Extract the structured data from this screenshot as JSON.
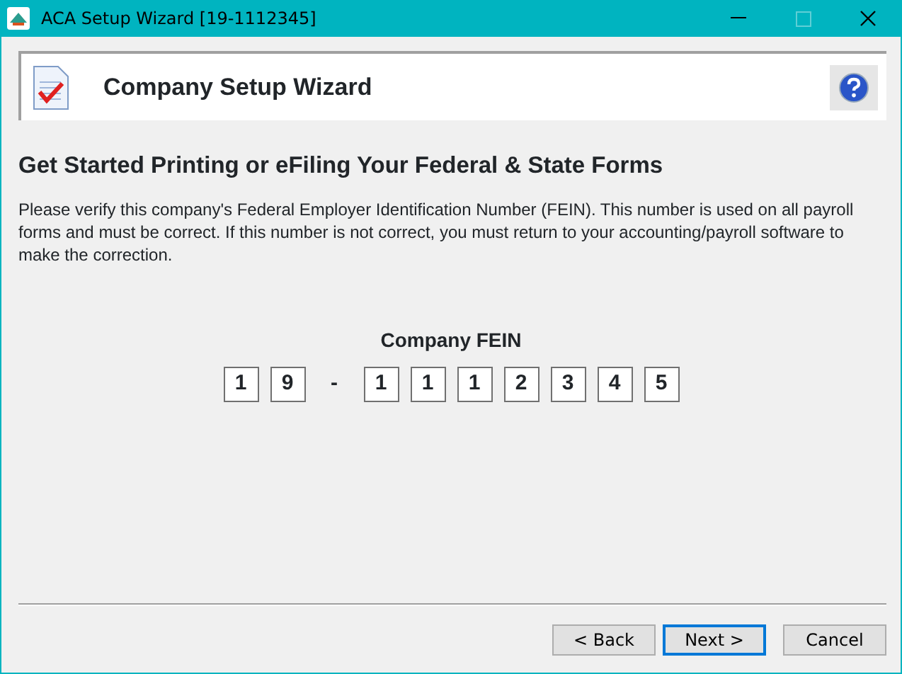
{
  "window": {
    "title": "ACA Setup Wizard [19-1112345]"
  },
  "header": {
    "title": "Company Setup Wizard"
  },
  "heading": "Get Started Printing or eFiling Your Federal & State Forms",
  "description": "Please verify this company's Federal Employer Identification Number (FEIN). This number is used on all payroll forms and must be correct. If this number is not correct, you must return to your accounting/payroll software to make the correction.",
  "fein": {
    "label": "Company FEIN",
    "characters": [
      {
        "kind": "digit",
        "text": "1"
      },
      {
        "kind": "digit",
        "text": "9"
      },
      {
        "kind": "dash",
        "text": "-"
      },
      {
        "kind": "digit",
        "text": "1"
      },
      {
        "kind": "digit",
        "text": "1"
      },
      {
        "kind": "digit",
        "text": "1"
      },
      {
        "kind": "digit",
        "text": "2"
      },
      {
        "kind": "digit",
        "text": "3"
      },
      {
        "kind": "digit",
        "text": "4"
      },
      {
        "kind": "digit",
        "text": "5"
      }
    ]
  },
  "buttons": [
    {
      "label": "< Back",
      "focused": false
    },
    {
      "label": "Next >",
      "focused": true
    },
    {
      "label": "Cancel",
      "focused": false
    }
  ]
}
